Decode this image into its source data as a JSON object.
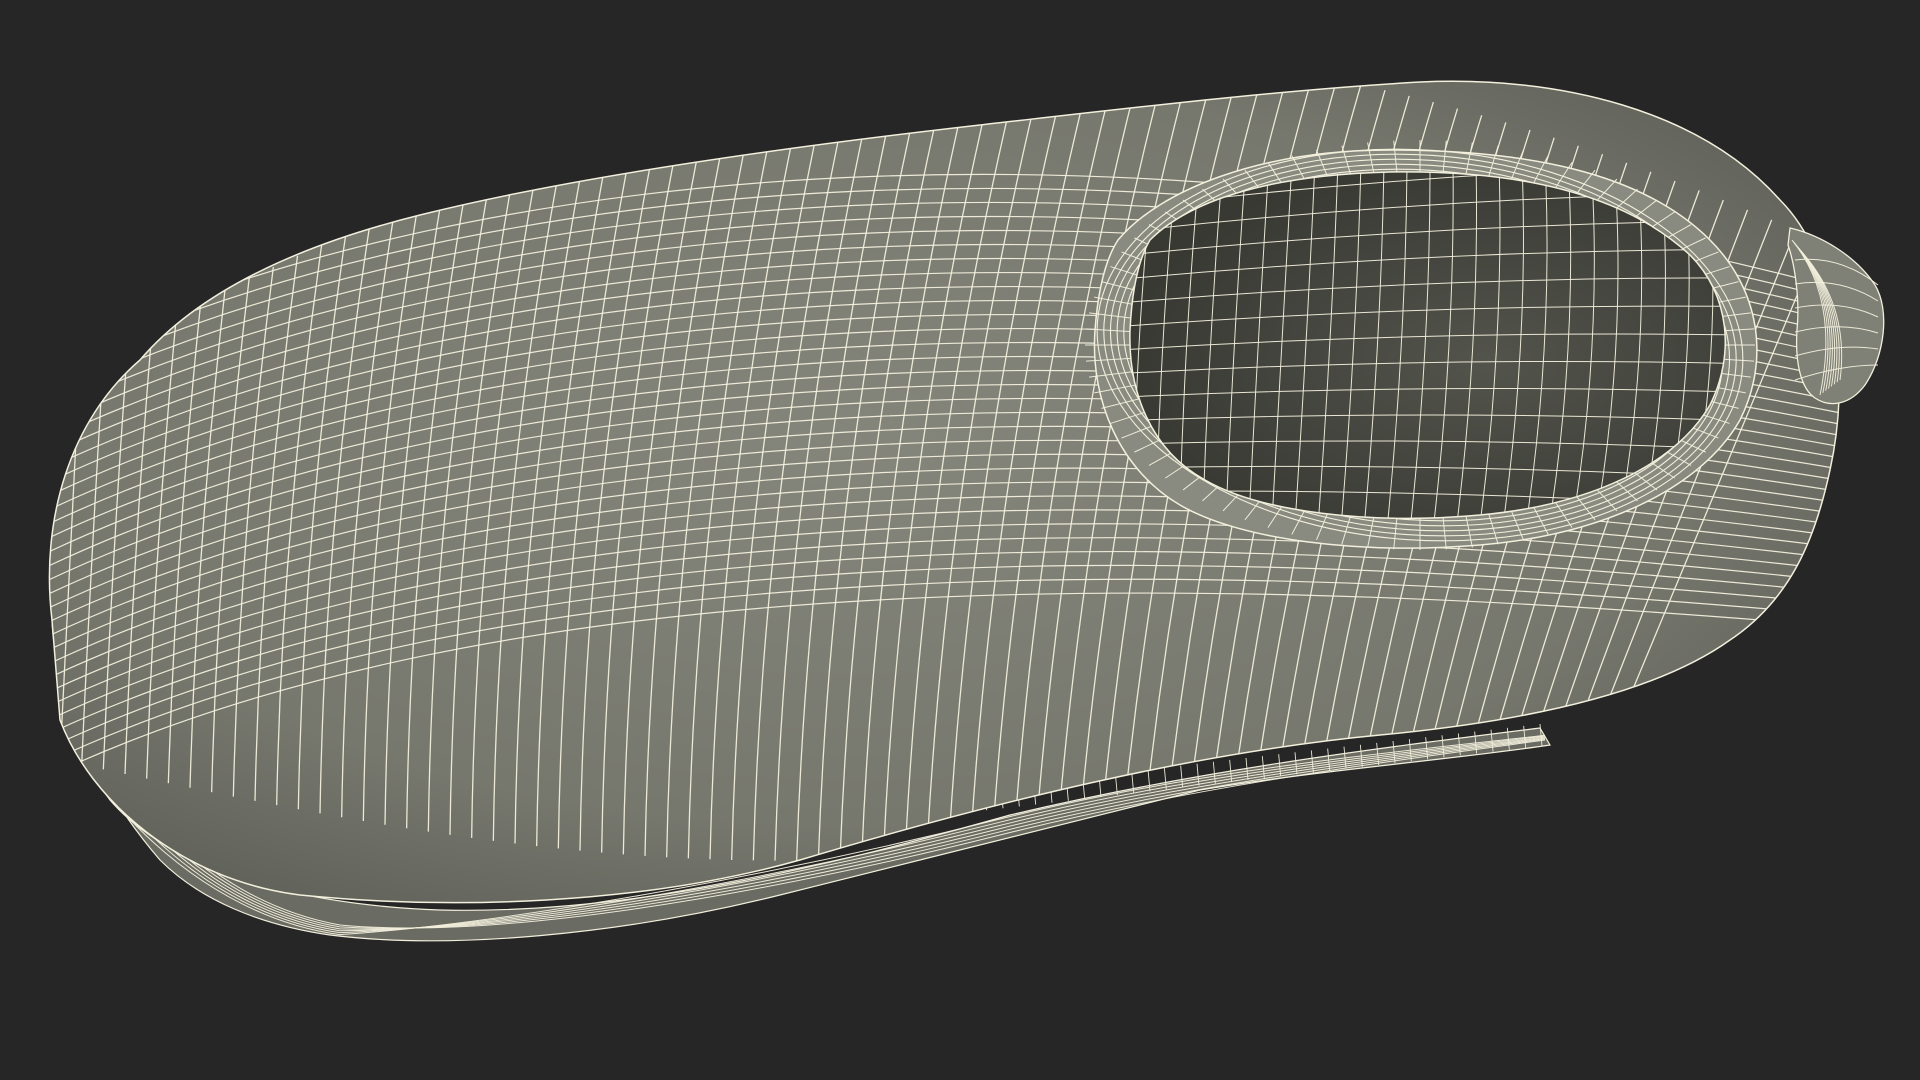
{
  "scene": {
    "background_color": "#262626",
    "surface_color": "#7c7d73",
    "surface_shadow_color": "#5f6058",
    "interior_color": "#3f403a",
    "wire_color": "#f2efdc",
    "subject_shape": "clog-shoe-wireframe"
  }
}
